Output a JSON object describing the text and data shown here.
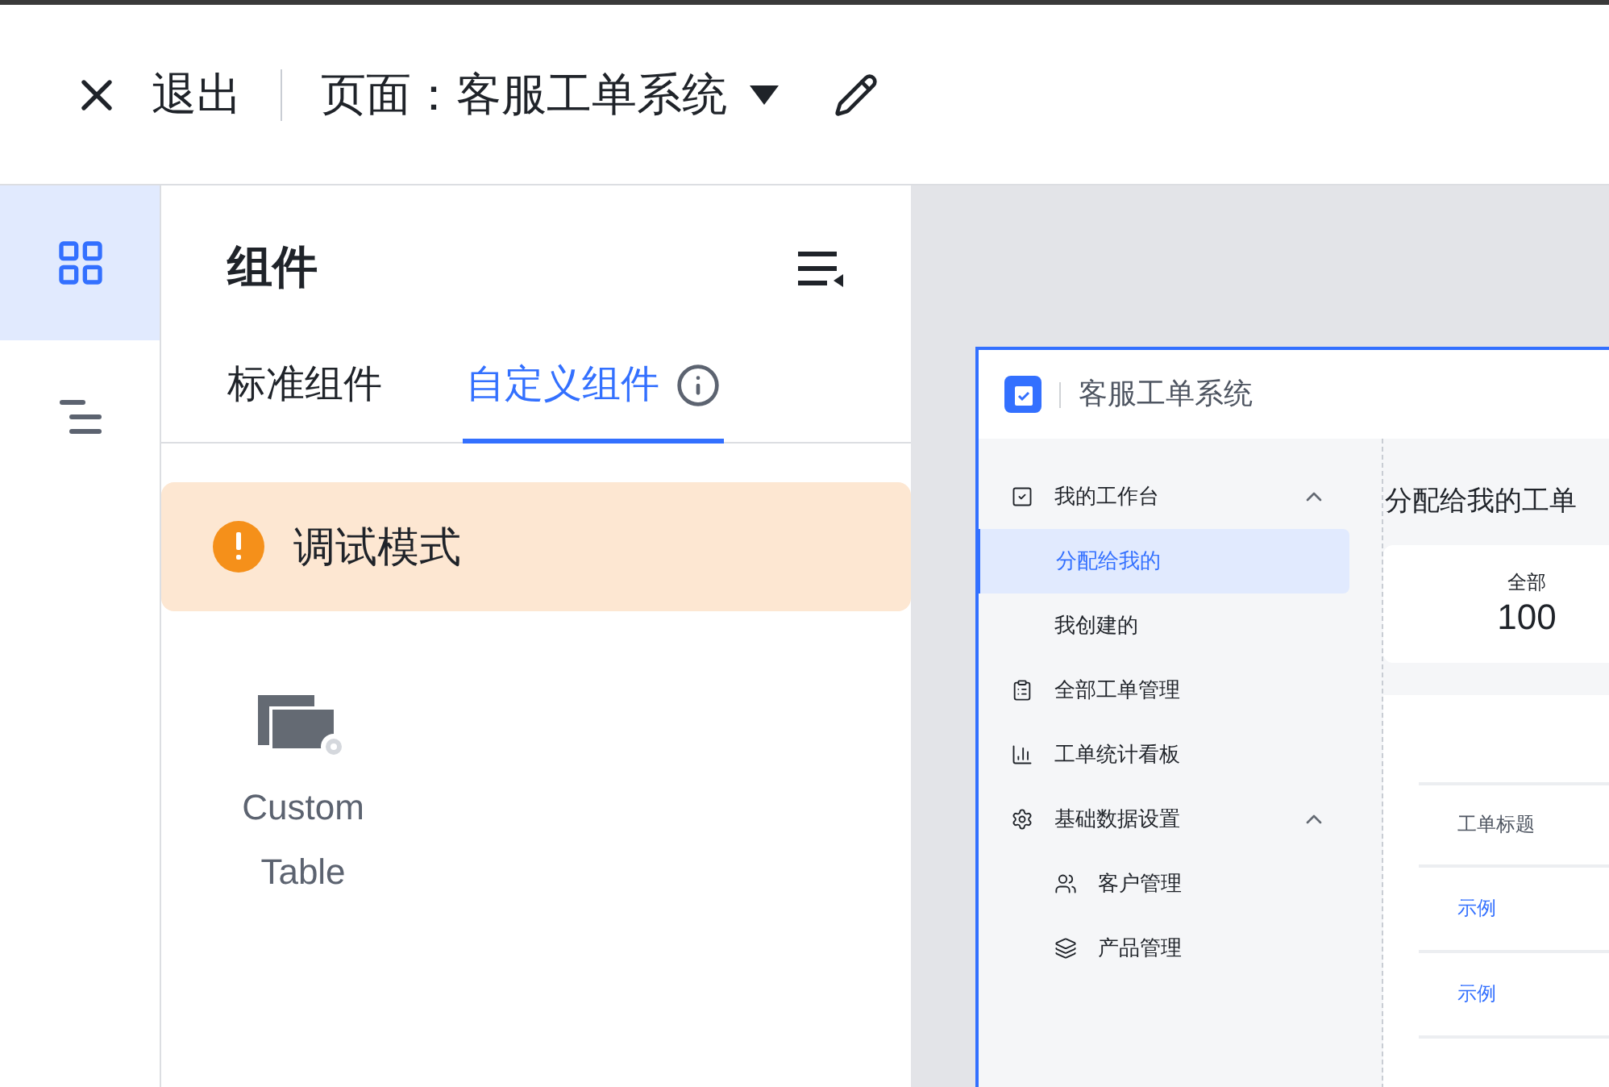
{
  "header": {
    "exit_label": "退出",
    "page_title": "页面：客服工单系统"
  },
  "rail": [
    {
      "selected": true
    },
    {
      "selected": false
    }
  ],
  "panel": {
    "title": "组件",
    "tabs": [
      {
        "label": "标准组件",
        "selected": false
      },
      {
        "label": "自定义组件",
        "selected": true
      }
    ],
    "notice": "调试模式",
    "components": [
      {
        "label": "Custom Table"
      }
    ]
  },
  "preview": {
    "app_title": "客服工单系统",
    "nav": [
      {
        "label": "我的工作台",
        "expanded": true,
        "children": [
          {
            "label": "分配给我的",
            "selected": true
          },
          {
            "label": "我创建的",
            "selected": false
          }
        ]
      },
      {
        "label": "全部工单管理"
      },
      {
        "label": "工单统计看板"
      },
      {
        "label": "基础数据设置",
        "expanded": true,
        "children": [
          {
            "label": "客户管理",
            "selected": false
          },
          {
            "label": "产品管理",
            "selected": false
          }
        ]
      }
    ],
    "section_title": "分配给我的工单",
    "stat": {
      "label": "全部",
      "value": "100"
    },
    "table": {
      "columns": [
        "工单标题"
      ],
      "rows": [
        [
          "示例"
        ],
        [
          "示例"
        ]
      ]
    }
  }
}
